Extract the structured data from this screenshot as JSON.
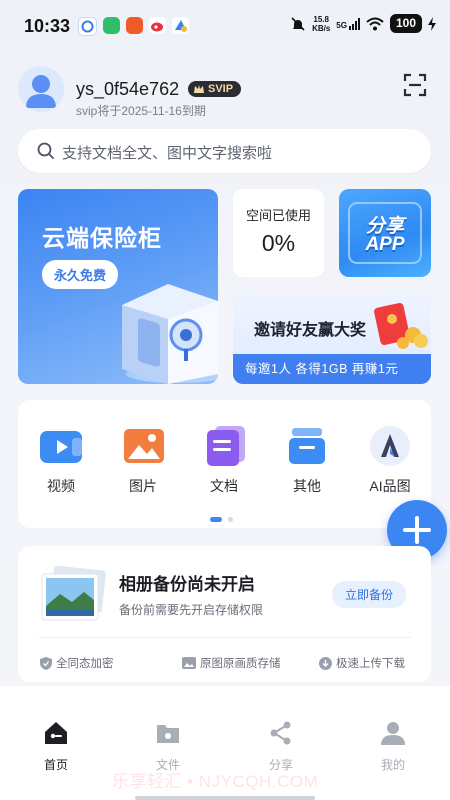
{
  "status_bar": {
    "time": "10:33",
    "net_speed": "15.8",
    "net_unit": "KB/s",
    "signal": "5G",
    "battery": "100"
  },
  "header": {
    "username": "ys_0f54e762",
    "badge": "SVIP",
    "expire_text": "svip将于2025-11-16到期"
  },
  "search": {
    "placeholder": "支持文档全文、图中文字搜索啦"
  },
  "promo": {
    "vault_title": "云端保险柜",
    "vault_button": "永久免费",
    "space_label": "空间已使用",
    "space_value": "0%",
    "share_line1": "分享",
    "share_line2": "APP",
    "invite_title": "邀请好友赢大奖",
    "invite_bar": "每邀1人 各得1GB 再赚1元"
  },
  "tools": [
    {
      "label": "视频"
    },
    {
      "label": "图片"
    },
    {
      "label": "文档"
    },
    {
      "label": "其他"
    },
    {
      "label": "AI品图"
    }
  ],
  "backup": {
    "title": "相册备份尚未开启",
    "desc": "备份前需要先开启存储权限",
    "button": "立即备份",
    "features": [
      "全同态加密",
      "原图原画质存储",
      "极速上传下载"
    ]
  },
  "nav": [
    {
      "label": "首页"
    },
    {
      "label": "文件"
    },
    {
      "label": "分享"
    },
    {
      "label": "我的"
    }
  ],
  "watermark": "乐享轻汇 • NJYCQH.COM",
  "colors": {
    "accent": "#3b86f3",
    "active_nav": "#1d1f24",
    "inactive_nav": "#a9adb6"
  }
}
